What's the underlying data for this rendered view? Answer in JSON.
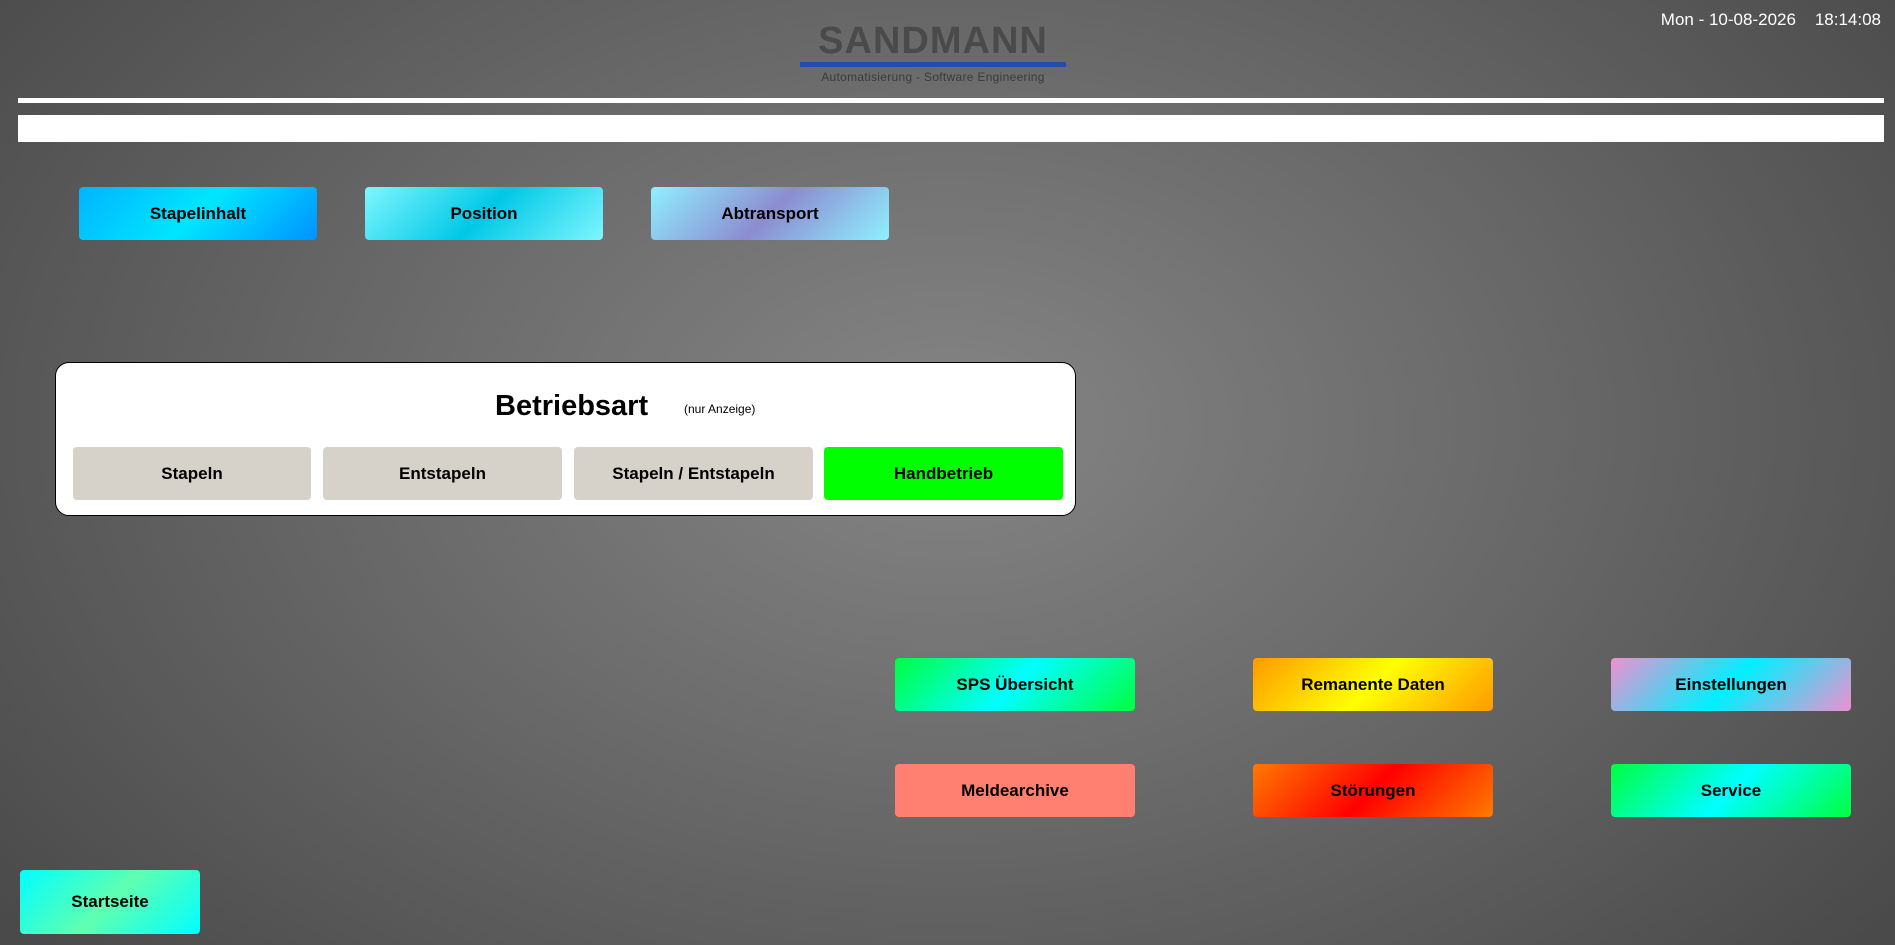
{
  "header": {
    "datetime": "Mon - 10-08-2026    18:14:08",
    "logo_text": "SANDMANN",
    "logo_subtitle": "Automatisierung - Software Engineering"
  },
  "message_bar": {
    "text": ""
  },
  "top_buttons": [
    {
      "label": "Stapelinhalt"
    },
    {
      "label": "Position"
    },
    {
      "label": "Abtransport"
    }
  ],
  "operating_mode": {
    "title": "Betriebsart",
    "note": "(nur Anzeige)",
    "modes": [
      {
        "label": "Stapeln",
        "active": false
      },
      {
        "label": "Entstapeln",
        "active": false
      },
      {
        "label": "Stapeln / Entstapeln",
        "active": false
      },
      {
        "label": "Handbetrieb",
        "active": true
      }
    ],
    "active_color": "#00ff00",
    "inactive_color": "#d6d1c9"
  },
  "nav_buttons": [
    {
      "label": "SPS Übersicht"
    },
    {
      "label": "Remanente Daten"
    },
    {
      "label": "Einstellungen"
    },
    {
      "label": "Meldearchive"
    },
    {
      "label": "Störungen"
    },
    {
      "label": "Service"
    }
  ],
  "home_button": {
    "label": "Startseite"
  }
}
